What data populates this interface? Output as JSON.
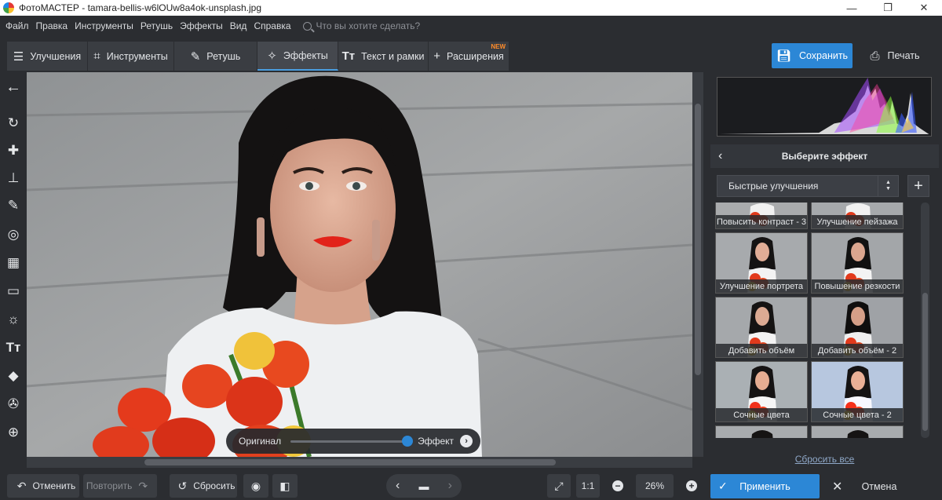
{
  "window": {
    "title": "ФотоМАСТЕР - tamara-bellis-w6lOUw8a4ok-unsplash.jpg",
    "minimize_glyph": "—",
    "maximize_glyph": "❐",
    "close_glyph": "✕"
  },
  "menu": {
    "items": [
      "Файл",
      "Правка",
      "Инструменты",
      "Ретушь",
      "Эффекты",
      "Вид",
      "Справка"
    ],
    "search_placeholder": "Что вы хотите сделать?"
  },
  "tabs": [
    {
      "label": "Улучшения",
      "icon": "sliders-icon"
    },
    {
      "label": "Инструменты",
      "icon": "crop-icon"
    },
    {
      "label": "Ретушь",
      "icon": "brush-icon"
    },
    {
      "label": "Эффекты",
      "icon": "magic-wand-icon",
      "active": true
    },
    {
      "label": "Текст и рамки",
      "icon": "text-icon"
    },
    {
      "label": "Расширения",
      "icon": "plus-icon",
      "badge": "NEW"
    }
  ],
  "actions": {
    "save_label": "Сохранить",
    "print_label": "Печать"
  },
  "left_tools": [
    "back-arrow-icon",
    "rotate-icon",
    "healing-icon",
    "stamp-icon",
    "brush-icon",
    "radial-icon",
    "gradient-icon",
    "vignette-icon",
    "light-icon",
    "text-icon",
    "fill-icon",
    "selection-icon",
    "crosshair-icon"
  ],
  "compare": {
    "original_label": "Оригинал",
    "effect_label": "Эффект",
    "value": 1.0
  },
  "panel": {
    "title": "Выберите эффект",
    "category": "Быстрые улучшения",
    "effects": [
      "Повысить контраст - 3",
      "Улучшение пейзажа",
      "Улучшение портрета",
      "Повышение резкости",
      "Добавить объём",
      "Добавить объём - 2",
      "Сочные цвета",
      "Сочные цвета - 2"
    ],
    "reset_all": "Сбросить все"
  },
  "bottom": {
    "undo_label": "Отменить",
    "redo_label": "Повторить",
    "reset_label": "Сбросить",
    "zoom_ratio": "1:1",
    "zoom_percent": "26%",
    "apply_label": "Применить",
    "cancel_label": "Отмена"
  },
  "colors": {
    "accent": "#2c87d6",
    "background": "#2b2d31",
    "badge": "#ff8c2a"
  }
}
